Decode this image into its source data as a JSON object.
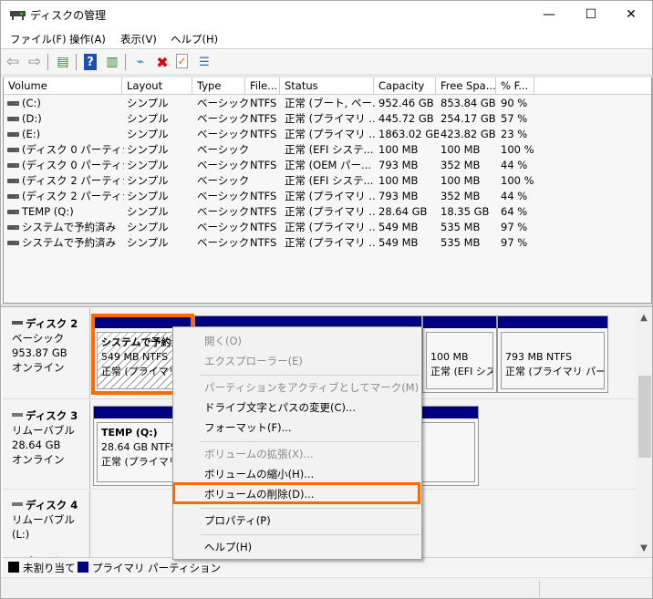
{
  "window": {
    "title": "ディスクの管理",
    "icon": "disk-management-icon",
    "controls": {
      "minimize": "—",
      "maximize": "☐",
      "close": "✕"
    }
  },
  "menubar": [
    {
      "label": "ファイル(F)"
    },
    {
      "label": "操作(A)"
    },
    {
      "label": "表示(V)"
    },
    {
      "label": "ヘルプ(H)"
    }
  ],
  "toolbar": [
    {
      "name": "back-icon",
      "glyph": "⇦"
    },
    {
      "name": "forward-icon",
      "glyph": "⇨"
    },
    {
      "name": "show-hide-console-tree-icon",
      "glyph": "▤"
    },
    {
      "name": "help-icon",
      "glyph": "?"
    },
    {
      "name": "show-hide-action-pane-icon",
      "glyph": "▥"
    },
    {
      "name": "connect-disk-icon",
      "glyph": "⌁"
    },
    {
      "name": "delete-icon",
      "glyph": "✖"
    },
    {
      "name": "properties-icon",
      "glyph": "✓"
    },
    {
      "name": "list-view-icon",
      "glyph": "☰"
    }
  ],
  "volume_list": {
    "columns": [
      "Volume",
      "Layout",
      "Type",
      "File...",
      "Status",
      "Capacity",
      "Free Spa...",
      "% F..."
    ],
    "rows": [
      [
        "(C:)",
        "シンプル",
        "ベーシック",
        "NTFS",
        "正常 (ブート, ペー...",
        "952.46 GB",
        "853.84 GB",
        "90 %"
      ],
      [
        "(D:)",
        "シンプル",
        "ベーシック",
        "NTFS",
        "正常 (プライマリ ...",
        "445.72 GB",
        "254.17 GB",
        "57 %"
      ],
      [
        "(E:)",
        "シンプル",
        "ベーシック",
        "NTFS",
        "正常 (プライマリ ...",
        "1863.02 GB",
        "423.82 GB",
        "23 %"
      ],
      [
        "(ディスク 0 パーティシ...",
        "シンプル",
        "ベーシック",
        "",
        "正常 (EFI システ...",
        "100 MB",
        "100 MB",
        "100 %"
      ],
      [
        "(ディスク 0 パーティシ...",
        "シンプル",
        "ベーシック",
        "NTFS",
        "正常 (OEM パー...",
        "793 MB",
        "352 MB",
        "44 %"
      ],
      [
        "(ディスク 2 パーティシ...",
        "シンプル",
        "ベーシック",
        "",
        "正常 (EFI システ...",
        "100 MB",
        "100 MB",
        "100 %"
      ],
      [
        "(ディスク 2 パーティシ...",
        "シンプル",
        "ベーシック",
        "NTFS",
        "正常 (プライマリ ...",
        "793 MB",
        "352 MB",
        "44 %"
      ],
      [
        "TEMP (Q:)",
        "シンプル",
        "ベーシック",
        "NTFS",
        "正常 (プライマリ ...",
        "28.64 GB",
        "18.35 GB",
        "64 %"
      ],
      [
        "システムで予約済み",
        "シンプル",
        "ベーシック",
        "NTFS",
        "正常 (プライマリ ...",
        "549 MB",
        "535 MB",
        "97 %"
      ],
      [
        "システムで予約済み",
        "シンプル",
        "ベーシック",
        "NTFS",
        "正常 (プライマリ ...",
        "549 MB",
        "535 MB",
        "97 %"
      ]
    ]
  },
  "disks": [
    {
      "name": "ディスク 2",
      "type": "ベーシック",
      "size": "953.87 GB",
      "state": "オンライン",
      "partitions": [
        {
          "title": "システムで予約済",
          "line1": "549 MB NTFS",
          "line2": "正常 (プライマリ パ"
        },
        {
          "title": "",
          "line1": "",
          "line2": ""
        },
        {
          "title": "",
          "line1": "100 MB",
          "line2": "正常 (EFI シス"
        },
        {
          "title": "",
          "line1": "793 MB NTFS",
          "line2": "正常 (プライマリ パーテ"
        }
      ]
    },
    {
      "name": "ディスク 3",
      "type": "リムーバブル",
      "size": "28.64 GB",
      "state": "オンライン",
      "partitions": [
        {
          "title": "TEMP  (Q:)",
          "line1": "28.64 GB NTFS",
          "line2": "正常 (プライマリ パ"
        }
      ]
    },
    {
      "name": "ディスク 4",
      "type": "リムーバブル (L:)",
      "size": "",
      "state": "メディアなし",
      "partitions": []
    }
  ],
  "legend": [
    {
      "label": "未割り当て",
      "color": "#000000"
    },
    {
      "label": "プライマリ パーティション",
      "color": "#000080"
    }
  ],
  "context_menu": {
    "items": [
      {
        "label": "開く(O)",
        "enabled": false
      },
      {
        "label": "エクスプローラー(E)",
        "enabled": false
      },
      {
        "label": "パーティションをアクティブとしてマーク(M)",
        "enabled": false
      },
      {
        "label": "ドライブ文字とパスの変更(C)...",
        "enabled": true
      },
      {
        "label": "フォーマット(F)...",
        "enabled": true
      },
      {
        "label": "ボリュームの拡張(X)...",
        "enabled": false
      },
      {
        "label": "ボリュームの縮小(H)...",
        "enabled": true
      },
      {
        "label": "ボリュームの削除(D)...",
        "enabled": true,
        "highlighted": true
      },
      {
        "label": "プロパティ(P)",
        "enabled": true
      },
      {
        "label": "ヘルプ(H)",
        "enabled": true
      }
    ]
  },
  "colors": {
    "primary_partition": "#000080",
    "highlight": "#ff6a00"
  }
}
